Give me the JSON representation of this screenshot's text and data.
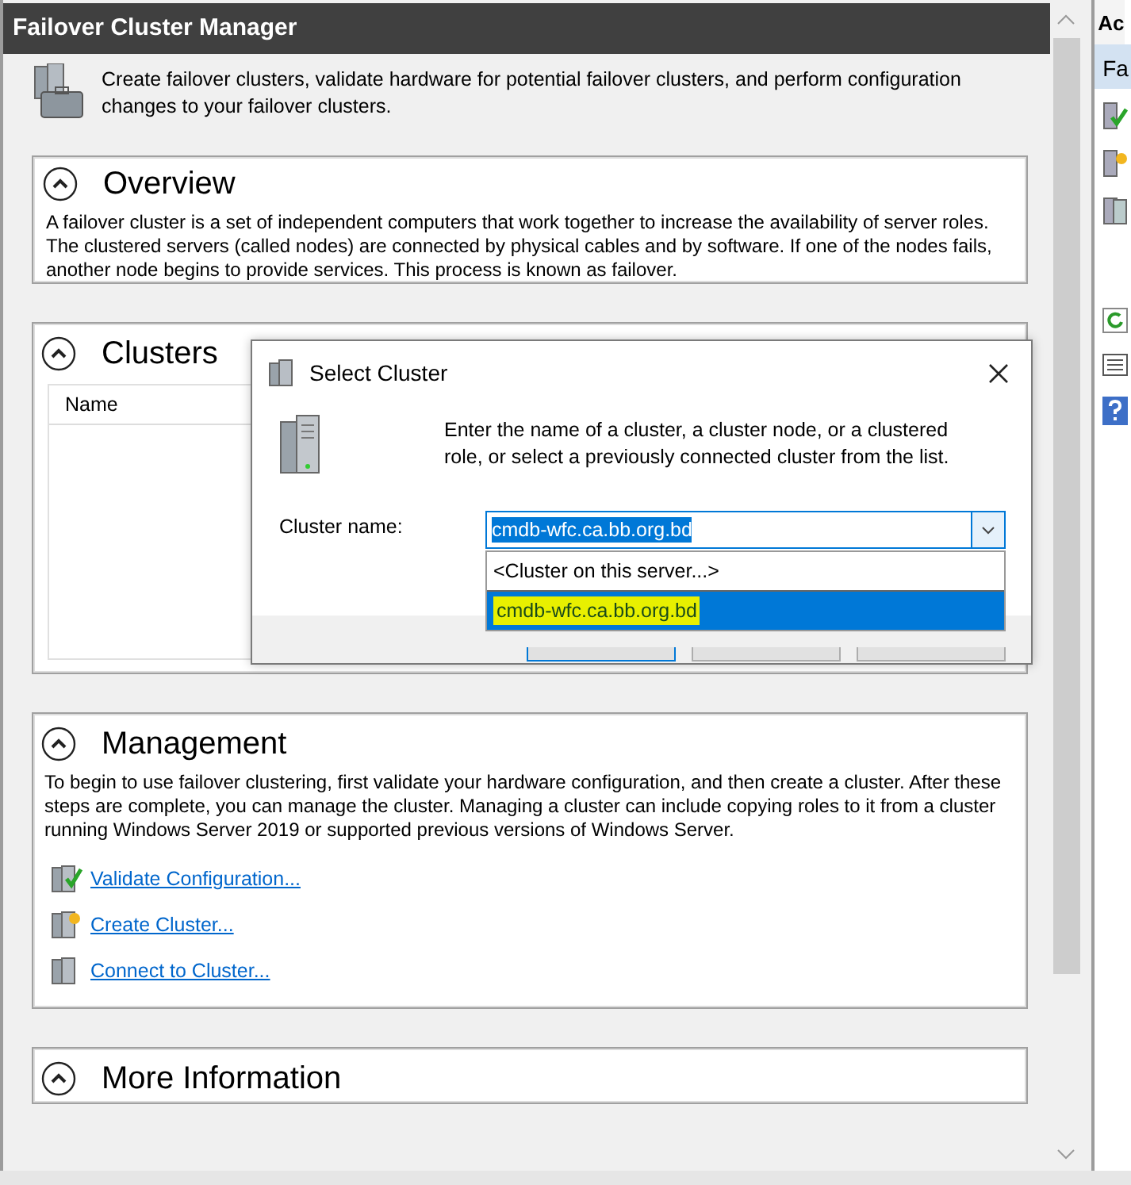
{
  "window": {
    "title": "Failover Cluster Manager"
  },
  "intro": {
    "text": "Create failover clusters, validate hardware for potential failover clusters, and perform configuration changes to your failover clusters."
  },
  "sections": [
    {
      "kind": "text",
      "title": "Overview",
      "expanded": true,
      "text": "A failover cluster is a set of independent computers that work together to increase the availability of server roles. The clustered servers (called nodes) are connected by physical cables and by software. If one of the nodes fails, another node begins to provide services. This process is known as failover."
    },
    {
      "kind": "table",
      "title": "Clusters",
      "expanded": true,
      "columns": [
        "Name"
      ]
    },
    {
      "kind": "links",
      "title": "Management",
      "expanded": true,
      "text": "To begin to use failover clustering, first validate your hardware configuration, and then create a cluster.  After these steps are complete, you can manage the cluster. Managing a cluster can include copying roles to it from a cluster running Windows Server 2019 or supported previous versions of Windows Server.",
      "links": [
        {
          "label": "Validate Configuration...",
          "kind": "validate"
        },
        {
          "label": "Create Cluster...",
          "kind": "create"
        },
        {
          "label": "Connect to Cluster...",
          "kind": "connect"
        }
      ]
    },
    {
      "kind": "header",
      "title": "More Information",
      "expanded": true
    }
  ],
  "actions_pane": {
    "header": "Ac",
    "items": [
      {
        "label": "Fa",
        "selected": true
      }
    ]
  },
  "dialog": {
    "title": "Select Cluster",
    "instructions": "Enter the name of a cluster, a cluster node, or a clustered role, or select a previously connected cluster from the list.",
    "field_label": "Cluster name:",
    "value": "cmdb-wfc.ca.bb.org.bd",
    "options": [
      {
        "label": "<Cluster on this server...>",
        "selected": false,
        "marker_highlight": false
      },
      {
        "label": "cmdb-wfc.ca.bb.org.bd",
        "selected": true,
        "marker_highlight": true
      }
    ]
  }
}
